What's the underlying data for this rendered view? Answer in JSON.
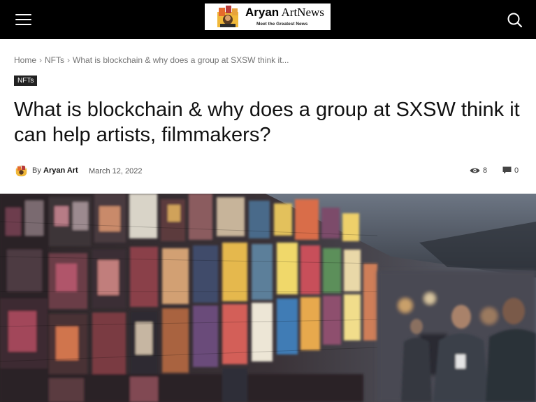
{
  "header": {
    "logo": {
      "brand_bold": "Aryan",
      "brand_rest": "ArtNews",
      "tagline": "Meet the Greatest News"
    },
    "icons": {
      "menu": "hamburger-menu-icon",
      "search": "search-icon"
    }
  },
  "breadcrumb": {
    "items": [
      "Home",
      "NFTs",
      "What is blockchain & why does a group at SXSW think it..."
    ],
    "separator": "›"
  },
  "article": {
    "category": "NFTs",
    "title": "What is blockchain & why does a group at SXSW think it can help artists, filmmakers?",
    "byline_prefix": "By",
    "author": "Aryan Art",
    "date": "March 12, 2022",
    "views": "8",
    "comments": "0"
  },
  "colors": {
    "topbar": "#000000",
    "category_badge": "#222222",
    "title_text": "#111111",
    "breadcrumb_text": "#747474"
  }
}
